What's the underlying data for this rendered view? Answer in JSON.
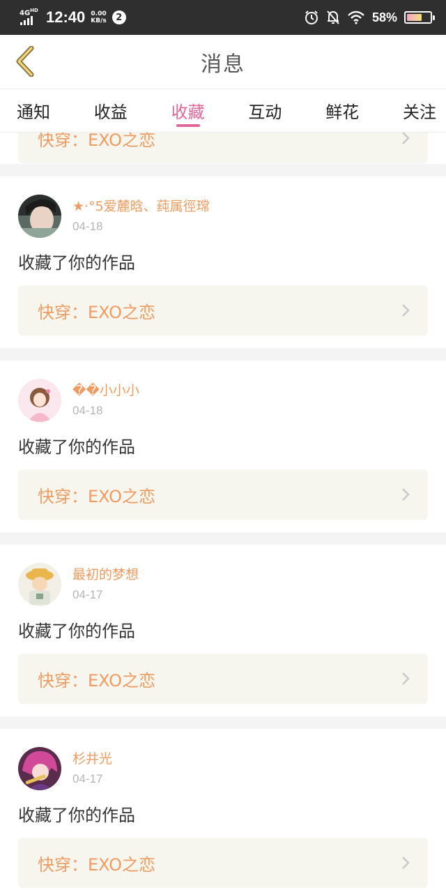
{
  "status_bar": {
    "network": "4G",
    "network_sup": "HD",
    "time": "12:40",
    "speed_value": "0.00",
    "speed_unit": "KB/s",
    "notif_badge": "2",
    "battery_percent": "58%",
    "battery_level": 0.58,
    "icons": [
      "alarm-icon",
      "bell-off-icon",
      "wifi-icon"
    ]
  },
  "header": {
    "title": "消息",
    "back_icon": "chevron-left-icon"
  },
  "tabs": [
    {
      "label": "通知",
      "active": false
    },
    {
      "label": "收益",
      "active": false
    },
    {
      "label": "收藏",
      "active": true
    },
    {
      "label": "互动",
      "active": false
    },
    {
      "label": "鲜花",
      "active": false
    },
    {
      "label": "关注",
      "active": false
    }
  ],
  "accent_color": "#e0679a",
  "highlight_color": "#ef9b60",
  "items": [
    {
      "username": "★·°5爱麓晗、莼属徑瑺",
      "date": "04-18",
      "action": "收藏了你的作品",
      "work_title": "快穿：EXO之恋"
    },
    {
      "username": "��小小小",
      "date": "04-18",
      "action": "收藏了你的作品",
      "work_title": "快穿：EXO之恋"
    },
    {
      "username": "最初的梦想",
      "date": "04-17",
      "action": "收藏了你的作品",
      "work_title": "快穿：EXO之恋"
    },
    {
      "username": "杉井光",
      "date": "04-17",
      "action": "收藏了你的作品",
      "work_title": "快穿：EXO之恋"
    }
  ],
  "partial_item": {
    "work_title": "快穿：EXO之恋"
  }
}
